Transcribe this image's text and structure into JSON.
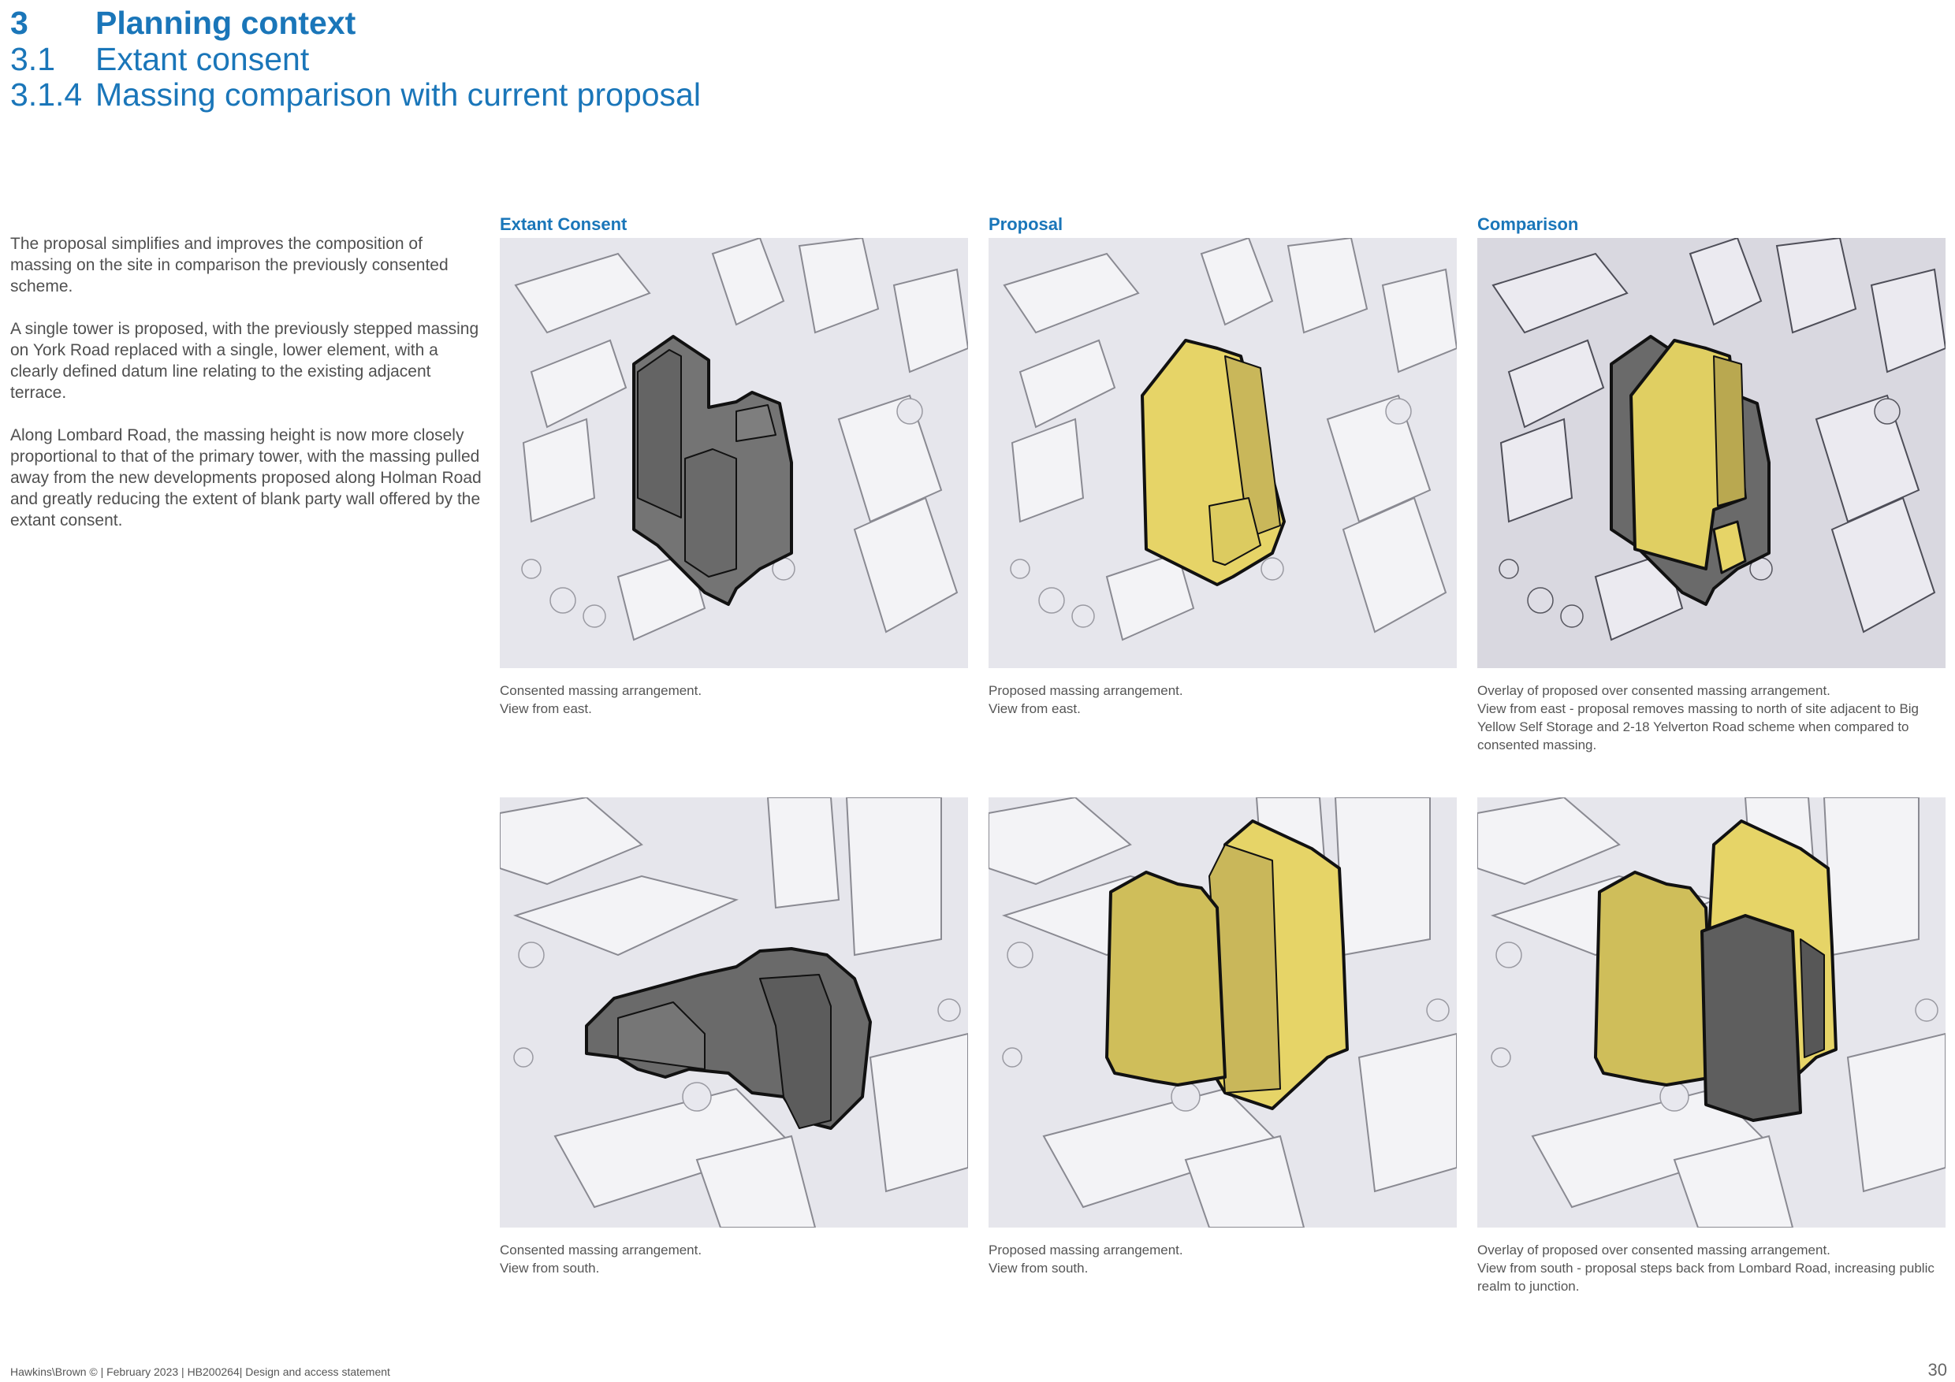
{
  "heading": {
    "section_number": "3",
    "section_title": "Planning context",
    "subsection_number": "3.1",
    "subsection_title": "Extant consent",
    "subsubsection_number": "3.1.4",
    "subsubsection_title": "Massing comparison with current proposal"
  },
  "intro": {
    "paragraphs": [
      "The proposal simplifies and improves the composition of massing on the site in comparison the previously consented scheme.",
      "A single tower is proposed, with the previously stepped massing on York Road replaced with a single, lower element, with a clearly defined datum line relating to the existing adjacent terrace.",
      "Along Lombard Road, the massing height is now more closely proportional to that of the primary tower, with the massing pulled away from the new developments proposed along Holman Road and greatly reducing the extent of blank party wall offered by the extant consent."
    ]
  },
  "columns": [
    {
      "title": "Extant Consent"
    },
    {
      "title": "Proposal"
    },
    {
      "title": "Comparison"
    }
  ],
  "captions": {
    "east": [
      [
        "Consented massing arrangement.",
        "View from east."
      ],
      [
        "Proposed massing arrangement.",
        "View from east."
      ],
      [
        "Overlay of proposed over consented massing arrangement.",
        "View from east - proposal removes massing to north of site adjacent to Big Yellow Self Storage and 2-18 Yelverton Road scheme when compared to consented massing."
      ]
    ],
    "south": [
      [
        "Consented massing arrangement.",
        "View from south."
      ],
      [
        "Proposed massing arrangement.",
        "View from south."
      ],
      [
        "Overlay of proposed over consented massing arrangement.",
        "View from south - proposal steps back from Lombard Road, increasing public realm to junction."
      ]
    ]
  },
  "colors": {
    "heading_blue": "#1a76b9",
    "proposal_yellow": "#e3d25e",
    "consent_grey": "#6e6e6e"
  },
  "footer": {
    "text": "Hawkins\\Brown © | February 2023 | HB200264| Design and access statement",
    "page_number": "30"
  }
}
